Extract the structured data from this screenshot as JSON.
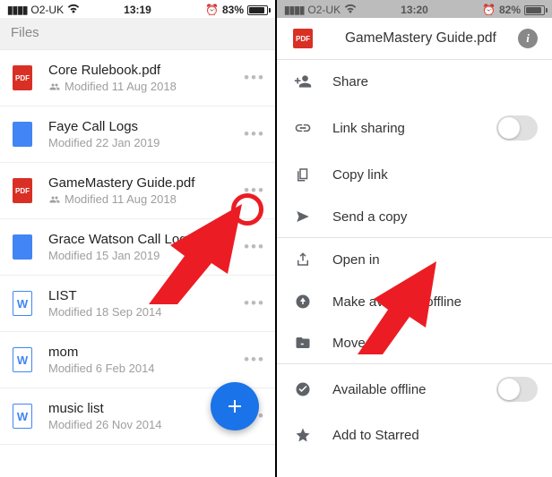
{
  "left": {
    "status": {
      "carrier": "O2-UK",
      "time": "13:19",
      "alarm": "⏰",
      "battery_pct": "83%",
      "battery_fill": 83
    },
    "header": "Files",
    "files": [
      {
        "icon": "pdf",
        "icon_label": "PDF",
        "name": "Core Rulebook.pdf",
        "shared": true,
        "meta": "Modified 11 Aug 2018"
      },
      {
        "icon": "doc",
        "icon_label": "",
        "name": "Faye Call Logs",
        "shared": false,
        "meta": "Modified 22 Jan 2019"
      },
      {
        "icon": "pdf",
        "icon_label": "PDF",
        "name": "GameMastery Guide.pdf",
        "shared": true,
        "meta": "Modified 11 Aug 2018"
      },
      {
        "icon": "doc",
        "icon_label": "",
        "name": "Grace Watson Call Logs",
        "shared": false,
        "meta": "Modified 15 Jan 2019"
      },
      {
        "icon": "word",
        "icon_label": "W",
        "name": "LIST",
        "shared": false,
        "meta": "Modified 18 Sep 2014"
      },
      {
        "icon": "word",
        "icon_label": "W",
        "name": "mom",
        "shared": false,
        "meta": "Modified 6 Feb 2014"
      },
      {
        "icon": "word",
        "icon_label": "W",
        "name": "music list",
        "shared": false,
        "meta": "Modified 26 Nov 2014"
      }
    ]
  },
  "right": {
    "status": {
      "carrier": "O2-UK",
      "time": "13:20",
      "alarm": "⏰",
      "battery_pct": "82%",
      "battery_fill": 82
    },
    "title": "GameMastery Guide.pdf",
    "options": {
      "share": "Share",
      "link_sharing": "Link sharing",
      "copy_link": "Copy link",
      "send_copy": "Send a copy",
      "open_in": "Open in",
      "make": "Make available offline",
      "move": "Move",
      "available_offline": "Available offline",
      "add_starred": "Add to Starred"
    }
  }
}
